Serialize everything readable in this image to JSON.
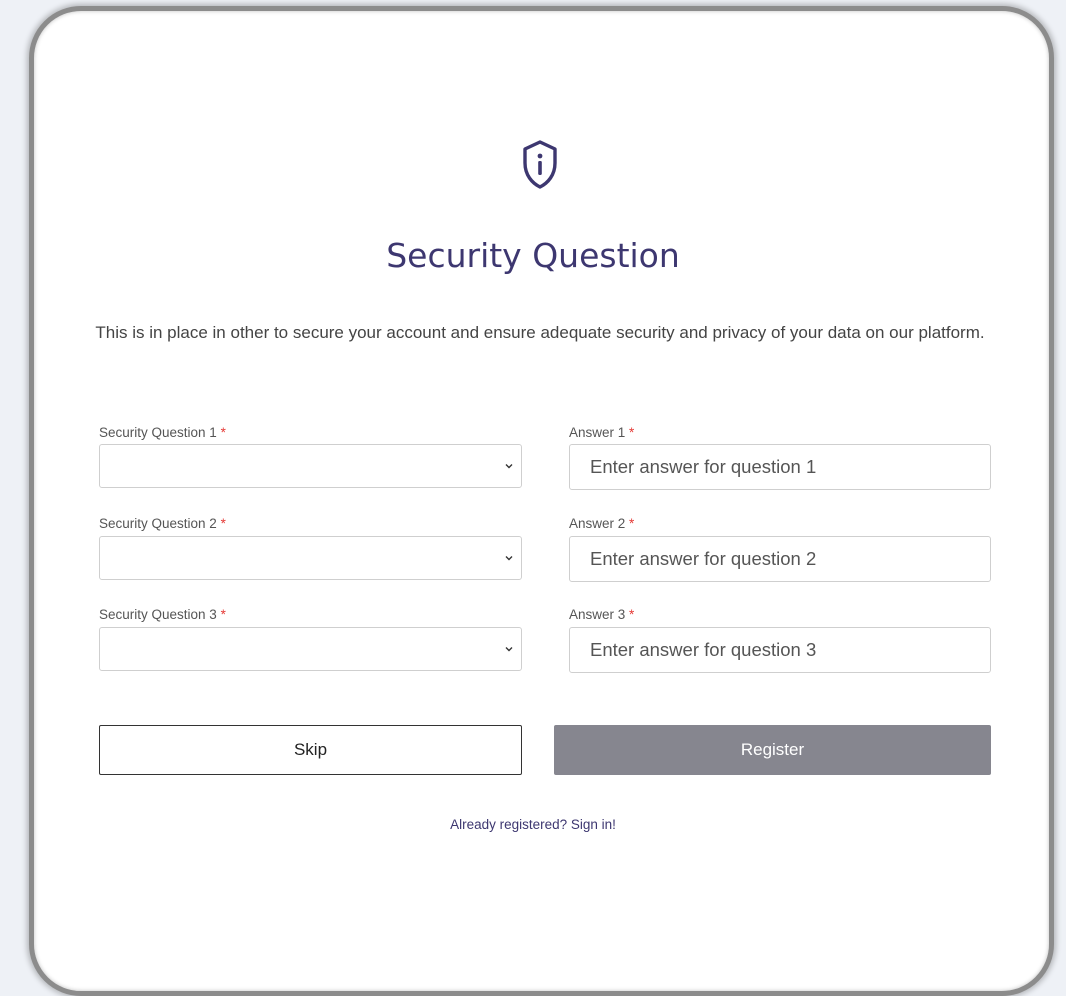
{
  "header": {
    "icon": "shield-info-icon",
    "title": "Security Question",
    "description": "This is in place in other to secure your account and ensure adequate security and privacy of your data on our platform."
  },
  "form": {
    "required_marker": "*",
    "questions": [
      {
        "label": "Security Question 1",
        "selected": ""
      },
      {
        "label": "Security Question 2",
        "selected": ""
      },
      {
        "label": "Security Question 3",
        "selected": ""
      }
    ],
    "answers": [
      {
        "label": "Answer 1",
        "placeholder": "Enter answer for question 1",
        "value": ""
      },
      {
        "label": "Answer 2",
        "placeholder": "Enter answer for question 2",
        "value": ""
      },
      {
        "label": "Answer 3",
        "placeholder": "Enter answer for question 3",
        "value": ""
      }
    ]
  },
  "actions": {
    "skip_label": "Skip",
    "register_label": "Register",
    "signin_link": "Already registered? Sign in!"
  },
  "colors": {
    "accent": "#3d3770",
    "register_bg": "#86868f",
    "required": "#e53935",
    "page_bg": "#eef1f6"
  }
}
